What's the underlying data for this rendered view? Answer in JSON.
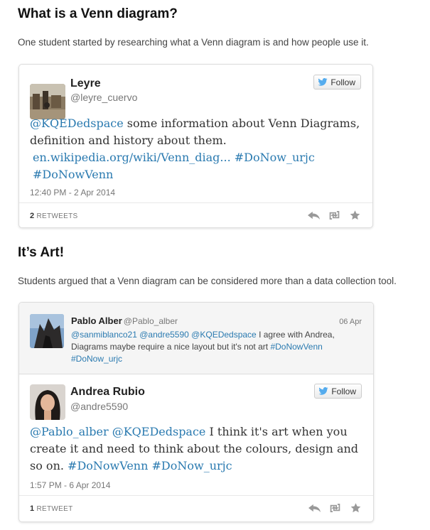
{
  "section1": {
    "heading": "What is a Venn diagram?",
    "intro": "One student started by researching what a Venn diagram is and how people use it."
  },
  "tweet1": {
    "name": "Leyre",
    "handle": "@leyre_cuervo",
    "follow_label": "Follow",
    "mention": "@KQEDedspace",
    "text_line1": " some information about Venn Diagrams,",
    "text_line2": "definition and history about them.",
    "link": "en.wikipedia.org/wiki/Venn_diag...",
    "hashtag1": "#DoNow_urjc",
    "hashtag2": "#DoNowVenn",
    "timestamp": "12:40 PM - 2 Apr 2014",
    "retweet_count": "2",
    "retweet_label": "RETWEETS"
  },
  "section2": {
    "heading": "It’s Art!",
    "intro": "Students argued that a Venn diagram can be considered more than a data collection tool."
  },
  "tweet2": {
    "parent": {
      "name": "Pablo Alber",
      "handle": "@Pablo_alber",
      "date": "06 Apr",
      "mention1": "@sanmiblanco21",
      "mention2": "@andre5590",
      "mention3": "@KQEDedspace",
      "text": " I agree with Andrea, Diagrams maybe require a nice layout but it's not art ",
      "hashtag1": "#DoNowVenn",
      "hashtag2": "#DoNow_urjc"
    },
    "name": "Andrea Rubio",
    "handle": "@andre5590",
    "follow_label": "Follow",
    "mention1": "@Pablo_alber",
    "mention2": "@KQEDedspace",
    "text_line1": " I think it's art when you",
    "text_line2": "create it and need to think about the colours, design and",
    "text_line3": "so on. ",
    "hashtag1": "#DoNowVenn",
    "hashtag2": "#DoNow_urjc",
    "timestamp": "1:57 PM - 6 Apr 2014",
    "retweet_count": "1",
    "retweet_label": "RETWEET"
  },
  "icons": {
    "follow": "twitter-bird-icon",
    "reply": "reply-icon",
    "retweet": "retweet-icon",
    "favorite": "star-icon"
  },
  "colors": {
    "link": "#2a7ab0",
    "twitter_blue": "#55acee"
  }
}
